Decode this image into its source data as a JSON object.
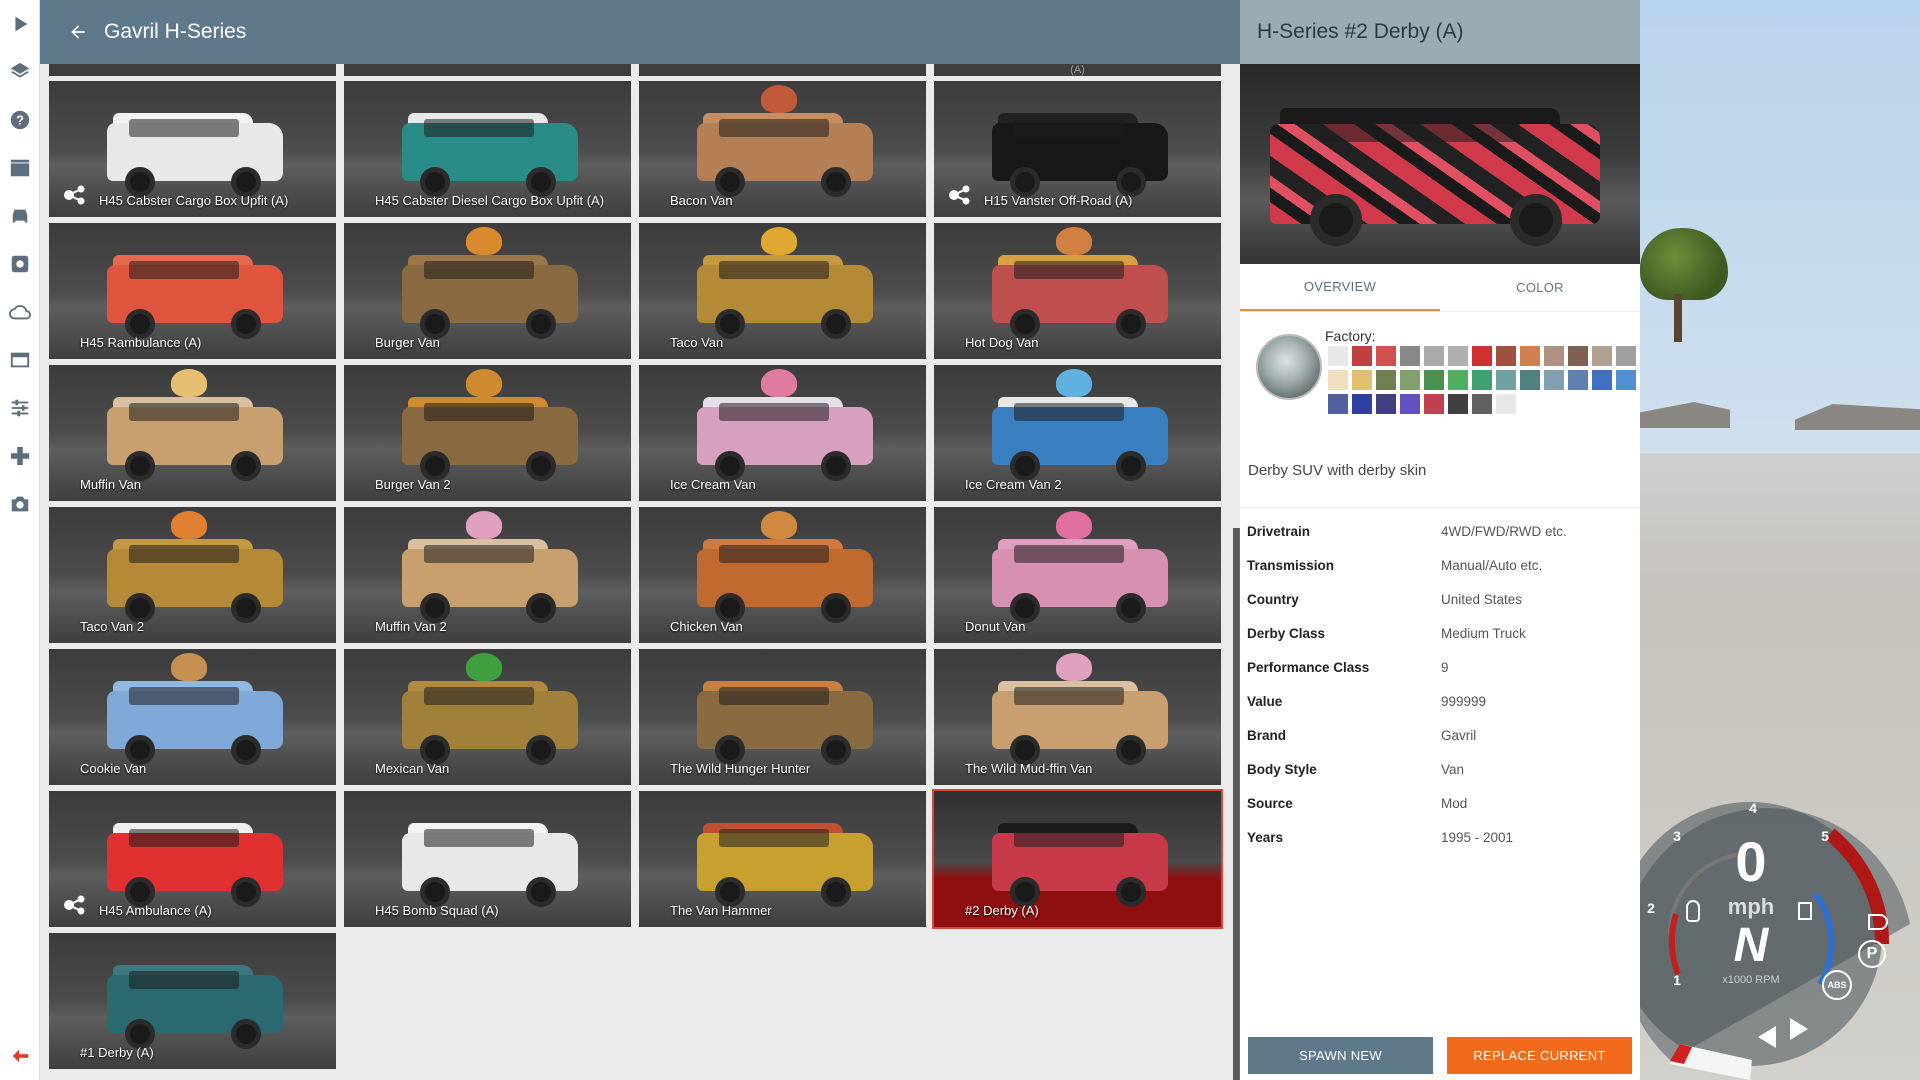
{
  "header": {
    "title": "Gavril H-Series"
  },
  "vehicles": [
    {
      "label": "H45 Cabster Cargo Box Upfit (A)",
      "has_config_icon": true,
      "body": "#e8e8e8",
      "roof": "#f2f2f2",
      "prop": ""
    },
    {
      "label": "H45 Cabster Diesel Cargo Box Upfit (A)",
      "has_config_icon": false,
      "body": "#2a8c88",
      "roof": "#e8e8e8",
      "prop": ""
    },
    {
      "label": "Bacon Van",
      "has_config_icon": false,
      "body": "#b57f55",
      "roof": "#c68e60",
      "prop": "#c25a3a"
    },
    {
      "label": "H15 Vanster Off-Road (A)",
      "has_config_icon": true,
      "body": "#181818",
      "roof": "#222222",
      "prop": ""
    },
    {
      "label": "H45 Rambulance (A)",
      "has_config_icon": false,
      "body": "#e0553e",
      "roof": "#e86a4e",
      "prop": ""
    },
    {
      "label": "Burger Van",
      "has_config_icon": false,
      "body": "#8a6a40",
      "roof": "#9a7648",
      "prop": "#d98a2c"
    },
    {
      "label": "Taco Van",
      "has_config_icon": false,
      "body": "#b48a36",
      "roof": "#c49a40",
      "prop": "#e0a830"
    },
    {
      "label": "Hot Dog Van",
      "has_config_icon": false,
      "body": "#c05050",
      "roof": "#d8a040",
      "prop": "#d08040"
    },
    {
      "label": "Muffin Van",
      "has_config_icon": false,
      "body": "#c8a070",
      "roof": "#d8c0a0",
      "prop": "#e6c070"
    },
    {
      "label": "Burger Van 2",
      "has_config_icon": false,
      "body": "#8a6a40",
      "roof": "#d08a30",
      "prop": "#d08a30"
    },
    {
      "label": "Ice Cream Van",
      "has_config_icon": false,
      "body": "#d8a0c0",
      "roof": "#e8e0e8",
      "prop": "#e07aa0"
    },
    {
      "label": "Ice Cream Van 2",
      "has_config_icon": false,
      "body": "#3a80c0",
      "roof": "#e8e8e8",
      "prop": "#60b0e0"
    },
    {
      "label": "Taco Van 2",
      "has_config_icon": false,
      "body": "#b48a36",
      "roof": "#c49a40",
      "prop": "#e08030"
    },
    {
      "label": "Muffin Van 2",
      "has_config_icon": false,
      "body": "#c8a070",
      "roof": "#d8c0a0",
      "prop": "#e0a0c0"
    },
    {
      "label": "Chicken Van",
      "has_config_icon": false,
      "body": "#c06a30",
      "roof": "#d07a40",
      "prop": "#d08a40"
    },
    {
      "label": "Donut Van",
      "has_config_icon": false,
      "body": "#d890b0",
      "roof": "#e0a0c0",
      "prop": "#e070a0"
    },
    {
      "label": "Cookie Van",
      "has_config_icon": false,
      "body": "#80a8d8",
      "roof": "#90b8e0",
      "prop": "#c89050"
    },
    {
      "label": "Mexican Van",
      "has_config_icon": false,
      "body": "#a0803a",
      "roof": "#b08a40",
      "prop": "#40a040"
    },
    {
      "label": "The Wild Hunger Hunter",
      "has_config_icon": false,
      "body": "#8a6a40",
      "roof": "#c88040",
      "prop": ""
    },
    {
      "label": "The Wild Mud-ffin Van",
      "has_config_icon": false,
      "body": "#c8a070",
      "roof": "#d8c0a0",
      "prop": "#e0a0c0"
    },
    {
      "label": "H45 Ambulance (A)",
      "has_config_icon": true,
      "body": "#e03030",
      "roof": "#f0f0f0",
      "prop": ""
    },
    {
      "label": "H45 Bomb Squad (A)",
      "has_config_icon": false,
      "body": "#e8e8e8",
      "roof": "#f4f4f4",
      "prop": ""
    },
    {
      "label": "The Van Hammer",
      "has_config_icon": false,
      "body": "#c8a030",
      "roof": "#c05030",
      "prop": ""
    },
    {
      "label": "#2 Derby (A)",
      "has_config_icon": false,
      "body": "#c83a4a",
      "roof": "#1a1a1a",
      "prop": "",
      "selected": true
    },
    {
      "label": "#1 Derby (A)",
      "has_config_icon": false,
      "body": "#2a6a70",
      "roof": "#3a7a80",
      "prop": ""
    }
  ],
  "top_row_ghost_label": "(A)",
  "detail": {
    "title": "H-Series #2 Derby (A)",
    "tabs": [
      "OVERVIEW",
      "COLOR"
    ],
    "factory_label": "Factory:",
    "description": "Derby SUV with derby skin",
    "specs": [
      {
        "key": "Drivetrain",
        "value": "4WD/FWD/RWD etc."
      },
      {
        "key": "Transmission",
        "value": "Manual/Auto etc."
      },
      {
        "key": "Country",
        "value": "United States"
      },
      {
        "key": "Derby Class",
        "value": "Medium Truck"
      },
      {
        "key": "Performance Class",
        "value": "9"
      },
      {
        "key": "Value",
        "value": "999999"
      },
      {
        "key": "Brand",
        "value": "Gavril"
      },
      {
        "key": "Body Style",
        "value": "Van"
      },
      {
        "key": "Source",
        "value": "Mod"
      },
      {
        "key": "Years",
        "value": "1995 - 2001"
      }
    ],
    "spawn_label": "SPAWN NEW",
    "replace_label": "REPLACE CURRENT",
    "swatch_colors": [
      "#e8e8e8",
      "#c04040",
      "#d05050",
      "#888888",
      "#aaaaaa",
      "#b0b0b0",
      "#d03030",
      "#a05040",
      "#d08050",
      "#b09080",
      "#806050",
      "#b0a090",
      "#a0a0a0",
      "#f0e0c0",
      "#e0c070",
      "#708050",
      "#80a070",
      "#4a9050",
      "#50b060",
      "#40a070",
      "#70a0a0",
      "#508080",
      "#80a0b0",
      "#6080b0",
      "#4070c0",
      "#5090d0",
      "#5060a0",
      "#3040a0",
      "#404080",
      "#6050c0",
      "#c04050",
      "#404040",
      "#606060",
      "#e8e8e8"
    ],
    "sidebar_icons": [
      "play-icon",
      "layers-icon",
      "help-icon",
      "clapperboard-icon",
      "car-icon",
      "settings-icon",
      "cloud-icon",
      "window-icon",
      "sliders-icon",
      "gamepad-icon",
      "camera-icon"
    ],
    "exit_icon": "exit-arrow-icon"
  },
  "gauge": {
    "gear": "N",
    "speed": "0",
    "unit": "mph",
    "rpm_label": "x1000 RPM",
    "ticks": [
      "1",
      "2",
      "3",
      "4",
      "5"
    ],
    "parking_label": "P",
    "abs_label": "ABS"
  }
}
